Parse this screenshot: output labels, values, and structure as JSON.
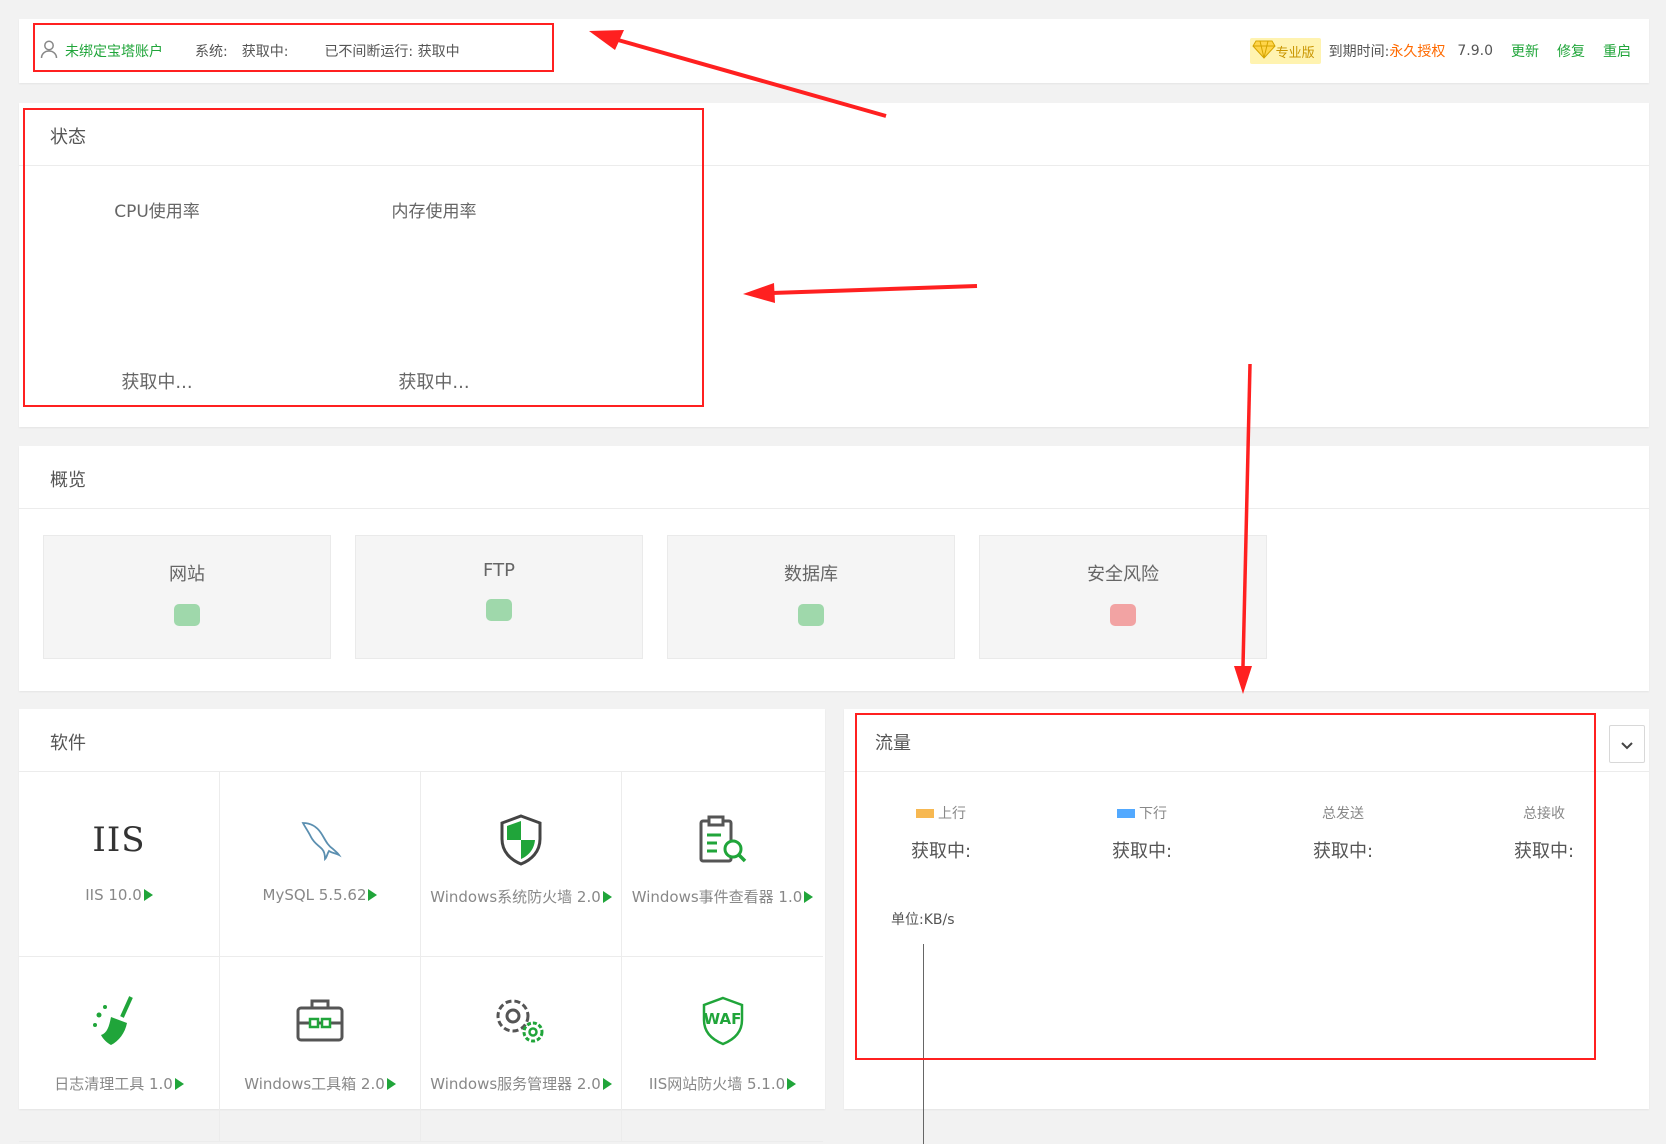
{
  "top_bar": {
    "account": "未绑定宝塔账户",
    "system_label": "系统:",
    "system_value": "获取中:",
    "uptime": "已不间断运行: 获取中",
    "badge": "专业版",
    "expiry_label": "到期时间:",
    "expiry_value": "永久授权",
    "version": "7.9.0",
    "update": "更新",
    "repair": "修复",
    "restart": "重启"
  },
  "status": {
    "title": "状态",
    "cpu_label": "CPU使用率",
    "cpu_value": "获取中...",
    "mem_label": "内存使用率",
    "mem_value": "获取中..."
  },
  "overview": {
    "title": "概览",
    "items": [
      {
        "name": "网站",
        "color": "#9fd8ab"
      },
      {
        "name": "FTP",
        "color": "#9fd8ab"
      },
      {
        "name": "数据库",
        "color": "#9fd8ab"
      },
      {
        "name": "安全风险",
        "color": "#f2a3a3"
      }
    ]
  },
  "software": {
    "title": "软件",
    "items": [
      {
        "label": "IIS 10.0",
        "icon": "iis-logo"
      },
      {
        "label": "MySQL 5.5.62",
        "icon": "mysql-dolphin-icon"
      },
      {
        "label": "Windows系统防火墙 2.0",
        "icon": "shield-icon"
      },
      {
        "label": "Windows事件查看器 1.0",
        "icon": "clipboard-search-icon"
      },
      {
        "label": "日志清理工具 1.0",
        "icon": "broom-icon"
      },
      {
        "label": "Windows工具箱 2.0",
        "icon": "toolbox-icon"
      },
      {
        "label": "Windows服务管理器 2.0",
        "icon": "gears-icon"
      },
      {
        "label": "IIS网站防火墙 5.1.0",
        "icon": "waf-shield-icon"
      }
    ],
    "iis_text": "IIS",
    "waf_text": "WAF"
  },
  "traffic": {
    "title": "流量",
    "up_label": "上行",
    "up_value": "获取中:",
    "down_label": "下行",
    "down_value": "获取中:",
    "total_sent_label": "总发送",
    "total_sent_value": "获取中:",
    "total_recv_label": "总接收",
    "total_recv_value": "获取中:",
    "unit": "单位:KB/s",
    "up_color": "#f7b851",
    "down_color": "#52a9ff"
  },
  "colors": {
    "accent": "#20a53a",
    "license": "#ff6a00",
    "annotation": "#ff2020"
  }
}
